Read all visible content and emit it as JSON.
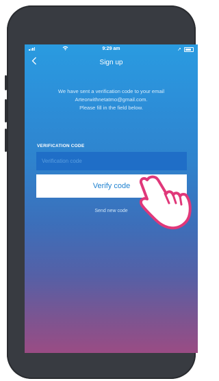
{
  "status_bar": {
    "time": "9:29 am"
  },
  "nav": {
    "title": "Sign up",
    "back_icon": "chevron-left-icon"
  },
  "message": {
    "line1": "We have sent a verification code to your email",
    "line2": "Arteorwithnetatmo@gmail.com.",
    "line3": "Please fill in the field below."
  },
  "form": {
    "label": "VERIFICATION CODE",
    "placeholder": "Verification code",
    "value": "",
    "verify_label": "Verify code",
    "send_new_label": "Send new code"
  },
  "colors": {
    "accent": "#1f82d0",
    "field_bg": "#1f6ec7",
    "hand_outline": "#e0387a"
  }
}
